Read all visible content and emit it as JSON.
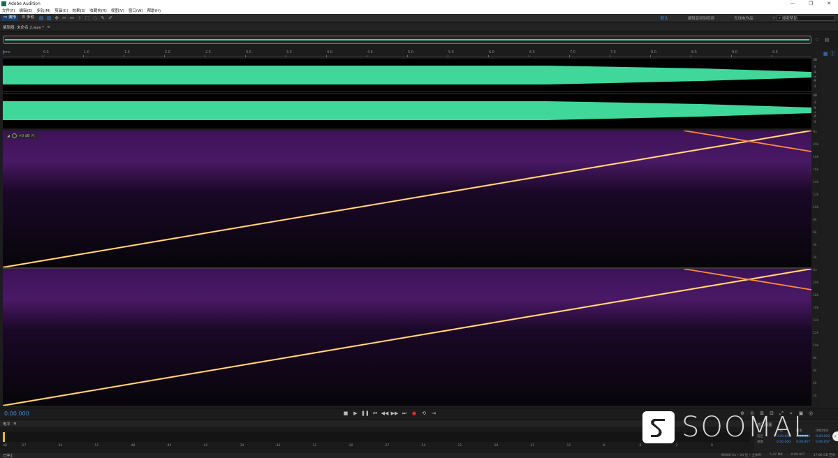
{
  "window": {
    "title": "Adobe Audition",
    "controls": [
      "—",
      "❐",
      "✕"
    ]
  },
  "menu": [
    "文件(F)",
    "编辑(E)",
    "多轨(M)",
    "剪辑(C)",
    "效果(S)",
    "收藏夹(R)",
    "视图(V)",
    "窗口(W)",
    "帮助(H)"
  ],
  "toolbar": {
    "waveform_label": "波形",
    "multitrack_label": "多轨",
    "workspaces": [
      "默认",
      "编辑音频到视频",
      "无线电作品"
    ],
    "search_placeholder": "搜索帮助"
  },
  "editor": {
    "tab_label": "编辑器: 未命名 2.wav *"
  },
  "ruler": {
    "unit": "hms",
    "ticks": [
      "0.5",
      "1.0",
      "1.5",
      "2.0",
      "2.5",
      "3.0",
      "3.5",
      "4.0",
      "4.5",
      "5.0",
      "5.5",
      "6.0",
      "6.5",
      "7.0",
      "7.5",
      "8.0",
      "8.5",
      "9.0",
      "9.5"
    ]
  },
  "db_scale": [
    "dB",
    "-3",
    "-9",
    "-∞",
    "-9",
    "-3",
    "dB",
    "-3",
    "-9",
    "-∞",
    "-9",
    "-3"
  ],
  "freq_scale": [
    "Hz",
    "20k",
    "18k",
    "16k",
    "14k",
    "12k",
    "10k",
    "8k",
    "6k",
    "4k",
    "2k",
    "1k",
    "Hz"
  ],
  "spectral_hud": {
    "level": "+0 dB"
  },
  "transport": {
    "timecode": "0:00.000"
  },
  "levels": {
    "panel_label": "电平",
    "scale": [
      "dB",
      "-57",
      "-54",
      "-51",
      "-48",
      "-45",
      "-42",
      "-39",
      "-36",
      "-33",
      "-30",
      "-27",
      "-24",
      "-21",
      "-18",
      "-15",
      "-12",
      "-9",
      "-6",
      "-3",
      "0"
    ]
  },
  "selection": {
    "panel_label": "选区/视图",
    "headers": [
      "",
      "开始",
      "结束",
      "持续时间"
    ],
    "rows": [
      {
        "name": "选区",
        "start": "0:00.000",
        "end": "0:00.000",
        "duration": "0:00.000"
      },
      {
        "name": "视图",
        "start": "0:00.000",
        "end": "0:09.957",
        "duration": "0:09.957"
      }
    ]
  },
  "status": {
    "left": "已停止",
    "right": [
      "96000 Hz • 24 位 • 立体声",
      "5.47 MB",
      "0:09.957",
      "17.66 GB 空闲"
    ]
  },
  "watermark": {
    "text": "SOOMAL"
  },
  "colors": {
    "accent": "#3d8be0",
    "waveform": "#3fd79a",
    "record": "#e02a2a"
  }
}
